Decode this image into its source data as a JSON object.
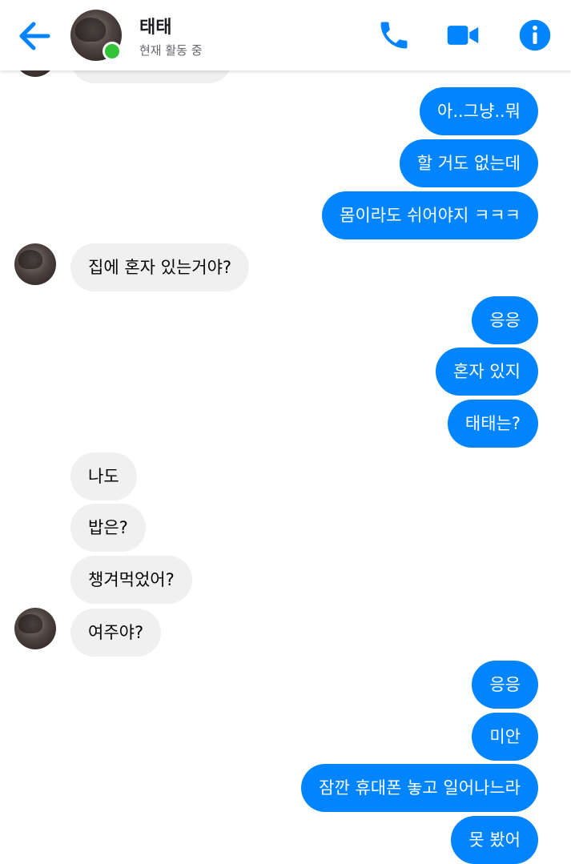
{
  "header": {
    "name": "태태",
    "status": "현재 활동 중",
    "accent": "#0084ff",
    "online_color": "#31c437"
  },
  "messages": [
    {
      "side": "in",
      "text": ""
    },
    {
      "side": "out",
      "text": "아..그냥..뭐"
    },
    {
      "side": "out",
      "text": "할 거도 없는데"
    },
    {
      "side": "out",
      "text": "몸이라도 쉬어야지 ㅋㅋㅋ"
    },
    {
      "side": "in",
      "text": "집에 혼자 있는거야?"
    },
    {
      "side": "out",
      "text": "응응"
    },
    {
      "side": "out",
      "text": "혼자 있지"
    },
    {
      "side": "out",
      "text": "태태는?"
    },
    {
      "side": "in",
      "text": "나도"
    },
    {
      "side": "in",
      "text": "밥은?"
    },
    {
      "side": "in",
      "text": "챙겨먹었어?"
    },
    {
      "side": "in",
      "text": "여주야?"
    },
    {
      "side": "out",
      "text": "응응"
    },
    {
      "side": "out",
      "text": "미안"
    },
    {
      "side": "out",
      "text": "잠깐 휴대폰 놓고 일어나느라"
    },
    {
      "side": "out",
      "text": "못 봤어"
    }
  ]
}
